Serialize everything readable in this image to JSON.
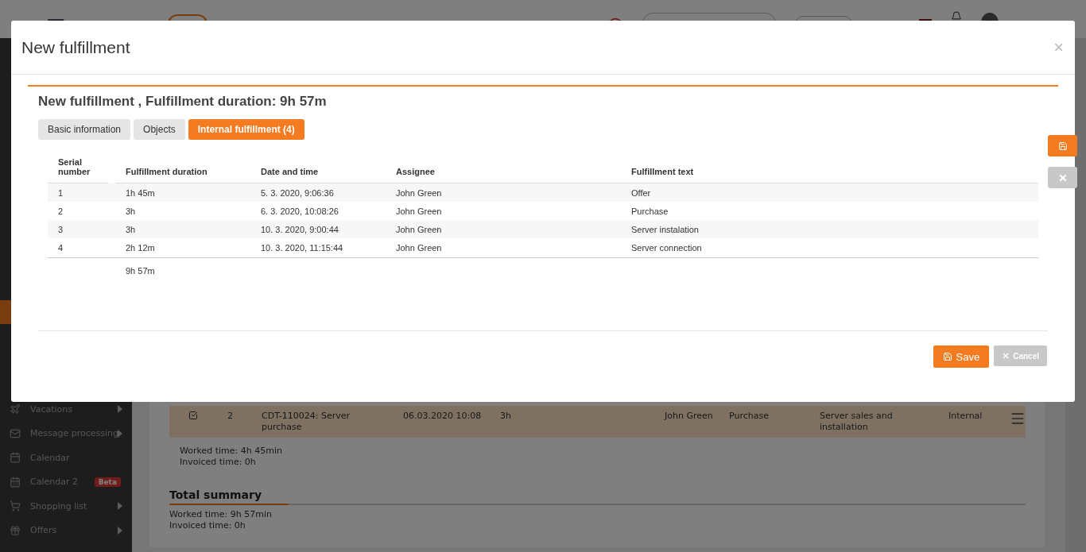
{
  "sidebar": {
    "items": [
      {
        "label": "Vacations",
        "submenu": true
      },
      {
        "label": "Message processing",
        "submenu": true
      },
      {
        "label": "Calendar",
        "submenu": false
      },
      {
        "label": "Calendar 2",
        "submenu": false,
        "badge": "Beta"
      },
      {
        "label": "Shopping list",
        "submenu": true
      },
      {
        "label": "Offers",
        "submenu": true
      }
    ]
  },
  "background": {
    "row": {
      "checked": true,
      "cells": [
        "2",
        "CDT-110024: Server purchase",
        "06.03.2020 10:08",
        "3h",
        "John Green",
        "Purchase",
        "Server sales and installation",
        "Internal"
      ]
    },
    "subtotal": [
      "Worked time: 4h 45min",
      "Invoiced time: 0h"
    ],
    "summary": {
      "title": "Total summary",
      "lines": [
        "Worked time: 9h 57min",
        "Invoiced time: 0h"
      ]
    }
  },
  "dialog": {
    "title": "New fulfillment",
    "close": "×",
    "heading": "New fulfillment , Fulfillment duration: 9h 57m",
    "tabs": [
      {
        "label": "Basic information",
        "selected": false
      },
      {
        "label": "Objects",
        "selected": false
      },
      {
        "label": "Internal fulfillment (4)",
        "selected": true
      }
    ],
    "table": {
      "columns": [
        "Serial number",
        "Fulfillment duration",
        "Date and time",
        "Assignee",
        "Fulfillment text"
      ],
      "rows": [
        [
          "1",
          "1h 45m",
          "5. 3. 2020, 9:06:36",
          "John Green",
          "Offer"
        ],
        [
          "2",
          "3h",
          "6. 3. 2020, 10:08:26",
          "John Green",
          "Purchase"
        ],
        [
          "3",
          "3h",
          "10. 3. 2020, 9:00:44",
          "John Green",
          "Server instalation"
        ],
        [
          "4",
          "2h 12m",
          "10. 3. 2020, 11:15:44",
          "John Green",
          "Server connection"
        ]
      ],
      "total": "9h 57m"
    },
    "save": "Save",
    "cancel": "Cancel"
  }
}
